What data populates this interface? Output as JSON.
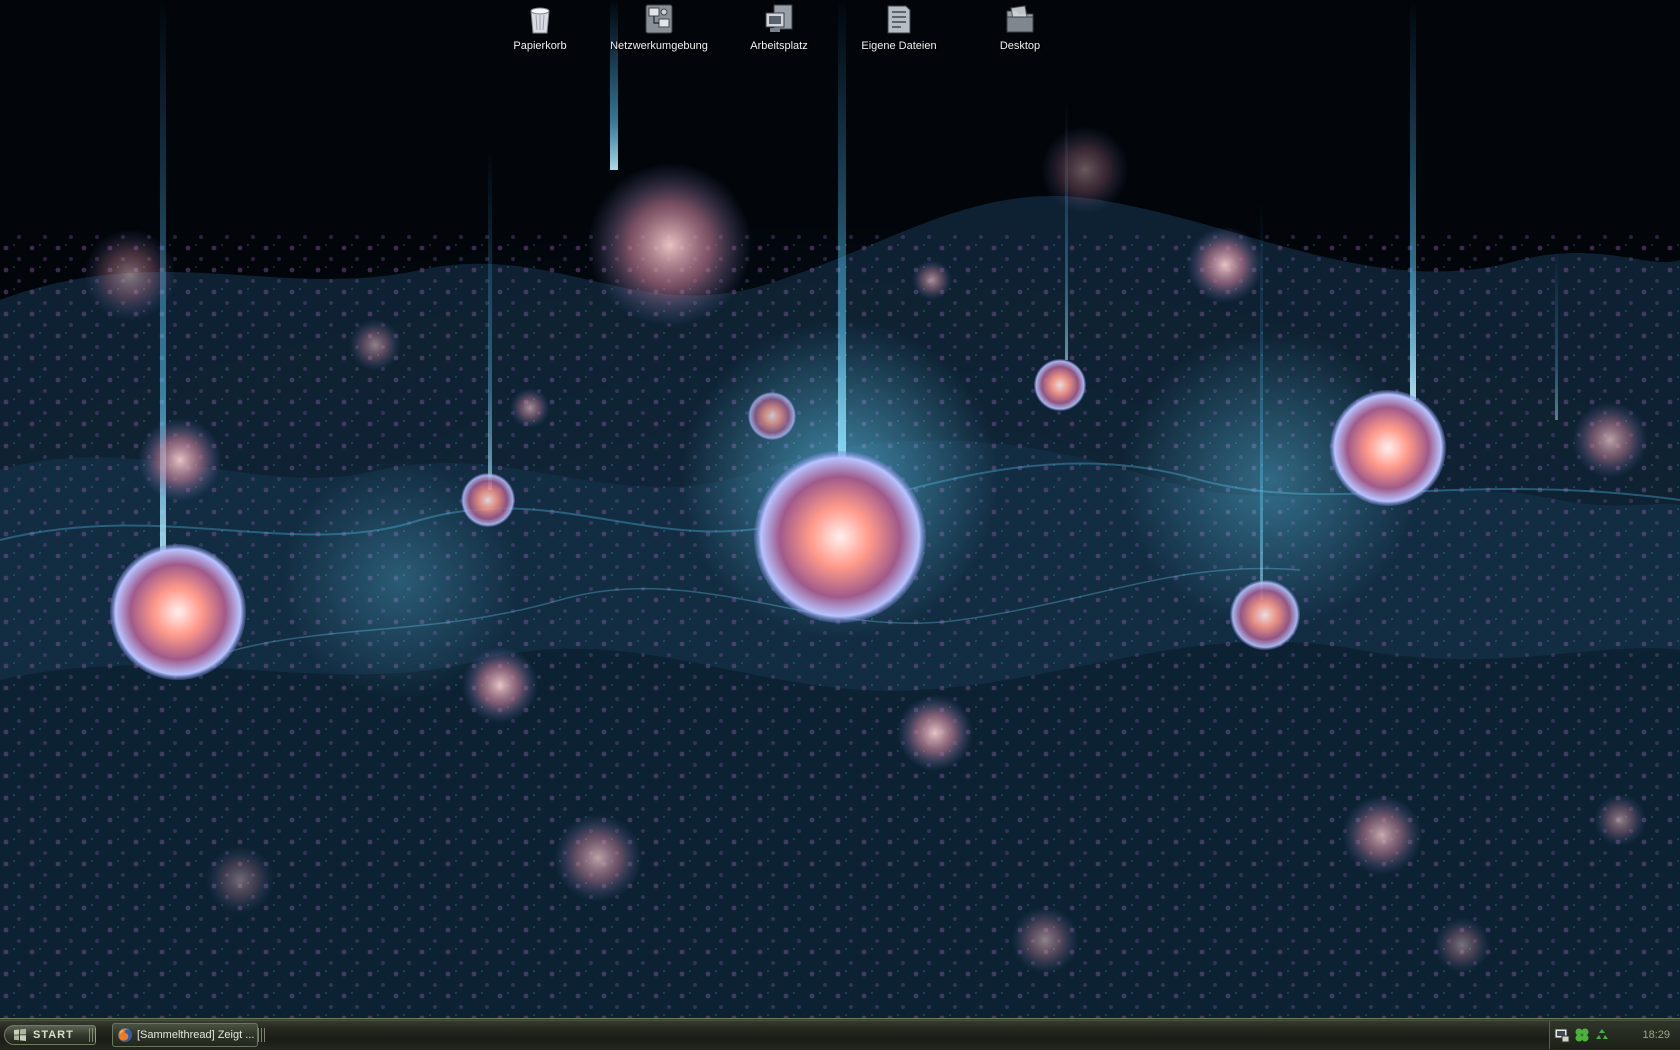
{
  "desktop_icons": [
    {
      "name": "recycle-bin-icon",
      "label": "Papierkorb"
    },
    {
      "name": "network-places-icon",
      "label": "Netzwerkumgebung"
    },
    {
      "name": "my-computer-icon",
      "label": "Arbeitsplatz"
    },
    {
      "name": "my-documents-icon",
      "label": "Eigene Dateien"
    },
    {
      "name": "desktop-folder-icon",
      "label": "Desktop"
    }
  ],
  "taskbar": {
    "start_label": "START",
    "tasks": [
      {
        "icon": "firefox-icon",
        "label": "[Sammelthread] Zeigt ..."
      }
    ],
    "tray": {
      "icons": [
        "network-icon",
        "clover-icon",
        "recycle-arrows-icon"
      ],
      "clock": "18:29"
    }
  },
  "colors": {
    "wallpaper_dark": "#02060b",
    "wallpaper_blue": "#1d3a52",
    "orb_glow": "#ff9a8a",
    "taskbar": "#26291f",
    "taskbar_border": "#6e7a5a",
    "clock_text": "#9aa58a"
  }
}
